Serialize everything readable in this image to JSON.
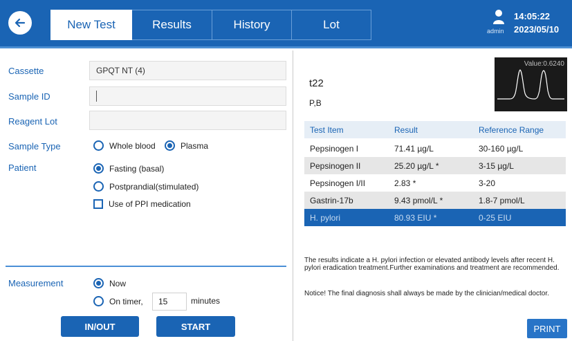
{
  "header": {
    "tabs": [
      {
        "label": "New Test",
        "active": true
      },
      {
        "label": "Results",
        "active": false
      },
      {
        "label": "History",
        "active": false
      },
      {
        "label": "Lot",
        "active": false
      }
    ],
    "user": "admin",
    "time": "14:05:22",
    "date": "2023/05/10",
    "colors": {
      "primary": "#1a64b4",
      "accent": "#4c8fd3"
    }
  },
  "form": {
    "cassette_label": "Cassette",
    "cassette_value": "GPQT NT (4)",
    "sample_id_label": "Sample ID",
    "sample_id_value": "",
    "reagent_lot_label": "Reagent Lot",
    "reagent_lot_value": "",
    "sample_type_label": "Sample Type",
    "sample_type_options": [
      {
        "label": "Whole blood",
        "checked": false
      },
      {
        "label": "Plasma",
        "checked": true
      }
    ],
    "patient_label": "Patient",
    "patient_options": [
      {
        "label": "Fasting (basal)",
        "checked": true
      },
      {
        "label": "Postprandial(stimulated)",
        "checked": false
      }
    ],
    "ppi_label": "Use of PPI medication",
    "ppi_checked": false,
    "measurement_label": "Measurement",
    "now_label": "Now",
    "now_checked": true,
    "on_timer_label": "On timer,",
    "timer_value": "15",
    "minutes_label": "minutes",
    "in_out_label": "IN/OUT",
    "start_label": "START"
  },
  "result": {
    "sample_name": "t22",
    "sample_type": "P,B",
    "graph_value": "Value:0.6240",
    "columns": [
      "Test Item",
      "Result",
      "Reference Range"
    ],
    "rows": [
      {
        "item": "Pepsinogen I",
        "result": "71.41 µg/L",
        "range": "30-160 µg/L"
      },
      {
        "item": "Pepsinogen II",
        "result": "25.20 µg/L *",
        "range": "3-15 µg/L"
      },
      {
        "item": "Pepsinogen I/II",
        "result": "2.83  *",
        "range": "3-20"
      },
      {
        "item": "Gastrin-17b",
        "result": "9.43 pmol/L *",
        "range": "1.8-7 pmol/L"
      },
      {
        "item": "H. pylori",
        "result": "80.93 EIU *",
        "range": "0-25 EIU"
      }
    ],
    "interpretation": "The results indicate a H. pylori infection or elevated antibody levels after recent H. pylori eradication treatment.Further examinations and treatment are recommended.",
    "notice": "Notice! The final diagnosis shall always be made by the clinician/medical doctor.",
    "print_label": "PRINT"
  }
}
